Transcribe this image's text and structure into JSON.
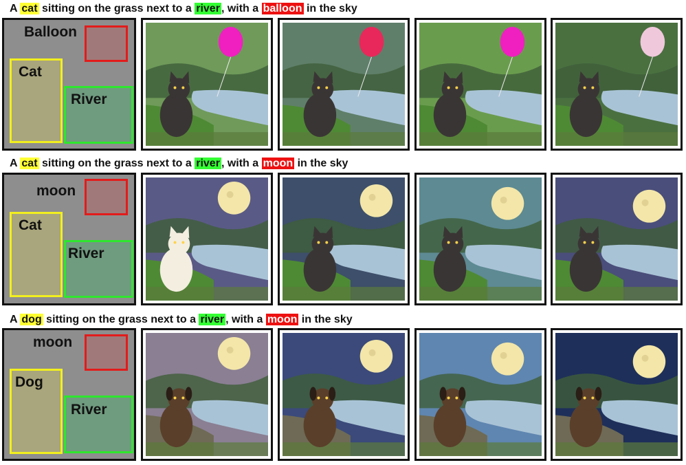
{
  "rows": [
    {
      "caption": {
        "prefix": "A ",
        "subject": "cat",
        "mid1": " sitting on the grass next to a ",
        "place": "river",
        "mid2": ", with a ",
        "object": "balloon",
        "suffix": " in the sky"
      },
      "layout": {
        "object_label": "Balloon",
        "subject_label": "Cat",
        "place_label": "River"
      },
      "images": [
        {
          "name": "cat-balloon-river-image",
          "subject": "cat",
          "object": "balloon",
          "sky": "#6f9a5a"
        },
        {
          "name": "cat-balloon-river-image",
          "subject": "cat",
          "object": "balloon",
          "sky": "#5f7f6a"
        },
        {
          "name": "cat-balloon-river-image",
          "subject": "cat",
          "object": "balloon",
          "sky": "#6a9c4e"
        },
        {
          "name": "cat-balloon-river-image",
          "subject": "cat",
          "object": "balloon",
          "sky": "#4a7040"
        }
      ]
    },
    {
      "caption": {
        "prefix": "A ",
        "subject": "cat",
        "mid1": " sitting on the grass next to a ",
        "place": "river",
        "mid2": ", with a ",
        "object": "moon",
        "suffix": " in the sky"
      },
      "layout": {
        "object_label": "moon",
        "subject_label": "Cat",
        "place_label": "River"
      },
      "images": [
        {
          "name": "cat-moon-river-image",
          "subject": "cat",
          "object": "moon",
          "sky": "#5a5a86"
        },
        {
          "name": "cat-moon-river-image",
          "subject": "cat",
          "object": "moon",
          "sky": "#3d4f6a"
        },
        {
          "name": "cat-moon-river-image",
          "subject": "cat",
          "object": "moon",
          "sky": "#5d8a93"
        },
        {
          "name": "cat-moon-river-image",
          "subject": "cat",
          "object": "moon",
          "sky": "#4a4e7a"
        }
      ]
    },
    {
      "caption": {
        "prefix": "A ",
        "subject": "dog",
        "mid1": " sitting on the grass next to a ",
        "place": "river",
        "mid2": ", with a ",
        "object": "moon",
        "suffix": " in the sky"
      },
      "layout": {
        "object_label": "moon",
        "subject_label": "Dog",
        "place_label": "River"
      },
      "images": [
        {
          "name": "dog-moon-river-image",
          "subject": "dog",
          "object": "moon",
          "sky": "#8a7f93"
        },
        {
          "name": "dog-moon-river-image",
          "subject": "dog",
          "object": "moon",
          "sky": "#3b4a7a"
        },
        {
          "name": "dog-moon-river-image",
          "subject": "dog",
          "object": "moon",
          "sky": "#5f86b0"
        },
        {
          "name": "dog-moon-river-image",
          "subject": "dog",
          "object": "moon",
          "sky": "#1e2f5a"
        }
      ]
    }
  ],
  "colors": {
    "subject_highlight": "#ffff33",
    "place_highlight": "#33ff33",
    "object_highlight": "#ee1111",
    "layout_bg": "#8e8e8e"
  }
}
